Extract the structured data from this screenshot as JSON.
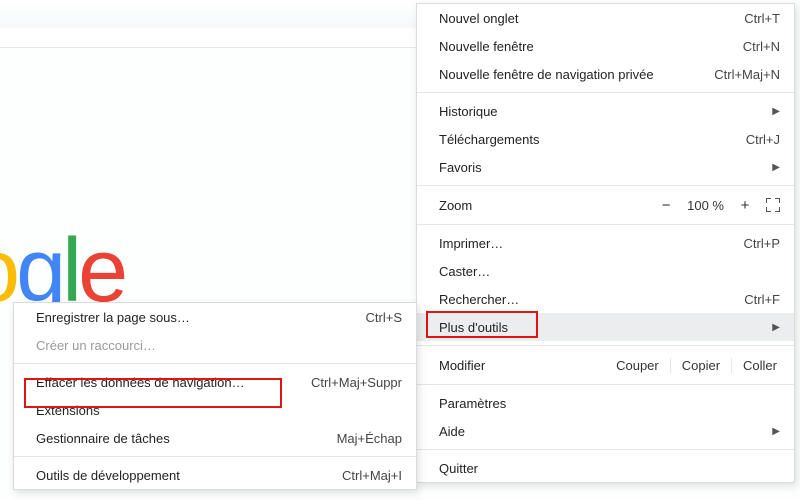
{
  "google_fragment": {
    "o": "o",
    "g": "g",
    "l": "l",
    "e": "e"
  },
  "main_menu": {
    "new_tab": {
      "label": "Nouvel onglet",
      "shortcut": "Ctrl+T"
    },
    "new_window": {
      "label": "Nouvelle fenêtre",
      "shortcut": "Ctrl+N"
    },
    "incognito": {
      "label": "Nouvelle fenêtre de navigation privée",
      "shortcut": "Ctrl+Maj+N"
    },
    "history": {
      "label": "Historique"
    },
    "downloads": {
      "label": "Téléchargements",
      "shortcut": "Ctrl+J"
    },
    "bookmarks": {
      "label": "Favoris"
    },
    "zoom": {
      "label": "Zoom",
      "minus": "−",
      "value": "100 %",
      "plus": "+"
    },
    "print": {
      "label": "Imprimer…",
      "shortcut": "Ctrl+P"
    },
    "cast": {
      "label": "Caster…"
    },
    "find": {
      "label": "Rechercher…",
      "shortcut": "Ctrl+F"
    },
    "more_tools": {
      "label": "Plus d'outils"
    },
    "edit": {
      "label": "Modifier",
      "cut": "Couper",
      "copy": "Copier",
      "paste": "Coller"
    },
    "settings": {
      "label": "Paramètres"
    },
    "help": {
      "label": "Aide"
    },
    "quit": {
      "label": "Quitter"
    }
  },
  "sub_menu": {
    "save_page": {
      "label": "Enregistrer la page sous…",
      "shortcut": "Ctrl+S"
    },
    "create_shortcut": {
      "label": "Créer un raccourci…"
    },
    "clear_data": {
      "label": "Effacer les données de navigation…",
      "shortcut": "Ctrl+Maj+Suppr"
    },
    "extensions": {
      "label": "Extensions"
    },
    "task_manager": {
      "label": "Gestionnaire de tâches",
      "shortcut": "Maj+Échap"
    },
    "dev_tools": {
      "label": "Outils de développement",
      "shortcut": "Ctrl+Maj+I"
    }
  }
}
